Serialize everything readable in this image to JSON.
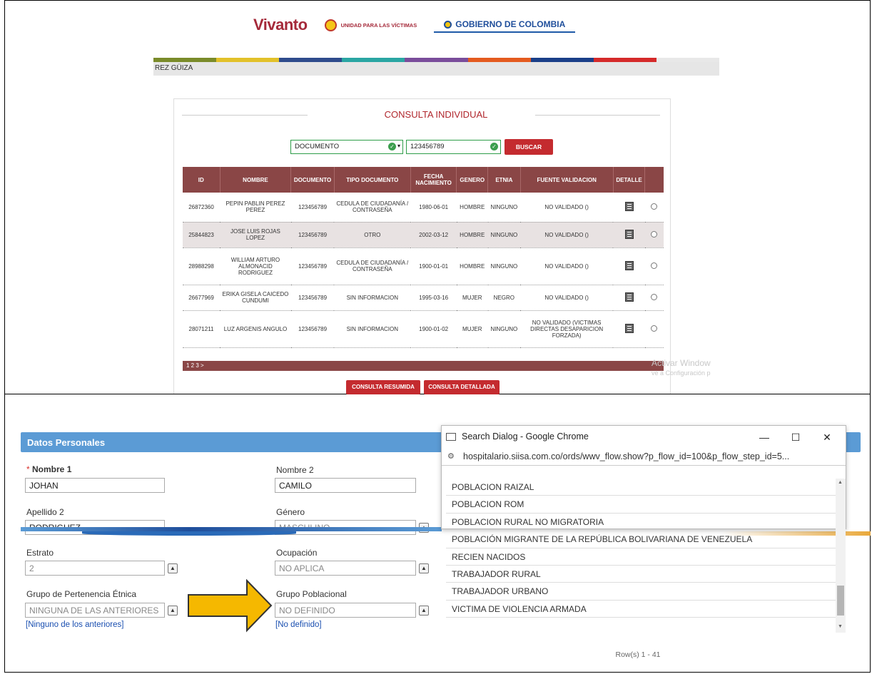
{
  "top": {
    "brand": {
      "vivanto": "Vivanto",
      "unidad": "UNIDAD PARA LAS VÍCTIMAS",
      "gobierno": "GOBIERNO DE COLOMBIA"
    },
    "user_name": "REZ GÜIZA",
    "strip_colors": [
      "#7a8b2a",
      "#e2c12a",
      "#2f4c8c",
      "#2ba6a3",
      "#7a4d9b",
      "#e45b1f",
      "#1a3f88",
      "#d52a2a",
      "#e8e8e8"
    ],
    "title": "CONSULTA INDIVIDUAL",
    "search": {
      "type_value": "DOCUMENTO",
      "doc_value": "123456789",
      "button": "BUSCAR"
    },
    "table": {
      "headers": [
        "ID",
        "NOMBRE",
        "DOCUMENTO",
        "TIPO DOCUMENTO",
        "FECHA NACIMIENTO",
        "GENERO",
        "ETNIA",
        "FUENTE VALIDACION",
        "DETALLE"
      ],
      "rows": [
        {
          "id": "26872360",
          "nombre": "PEPIN PABLIN PEREZ PEREZ",
          "documento": "123456789",
          "tipo": "CEDULA DE CIUDADANÍA / CONTRASEÑA",
          "fecha": "1980-06-01",
          "genero": "HOMBRE",
          "etnia": "NINGUNO",
          "fuente": "NO VALIDADO ()"
        },
        {
          "id": "25844823",
          "nombre": "JOSE LUIS ROJAS LOPEZ",
          "documento": "123456789",
          "tipo": "OTRO",
          "fecha": "2002-03-12",
          "genero": "HOMBRE",
          "etnia": "NINGUNO",
          "fuente": "NO VALIDADO ()"
        },
        {
          "id": "28988298",
          "nombre": "WILLIAM ARTURO ALMONACID RODRIGUEZ",
          "documento": "123456789",
          "tipo": "CEDULA DE CIUDADANÍA / CONTRASEÑA",
          "fecha": "1900-01-01",
          "genero": "HOMBRE",
          "etnia": "NINGUNO",
          "fuente": "NO VALIDADO ()"
        },
        {
          "id": "26677969",
          "nombre": "ERIKA GISELA CAICEDO CUNDUMI",
          "documento": "123456789",
          "tipo": "SIN INFORMACION",
          "fecha": "1995-03-16",
          "genero": "MUJER",
          "etnia": "NEGRO",
          "fuente": "NO VALIDADO ()"
        },
        {
          "id": "28071211",
          "nombre": "LUZ ARGENIS ANGULO",
          "documento": "123456789",
          "tipo": "SIN INFORMACION",
          "fecha": "1900-01-02",
          "genero": "MUJER",
          "etnia": "NINGUNO",
          "fuente": "NO VALIDADO (VICTIMAS DIRECTAS DESAPARICION FORZADA)"
        }
      ],
      "pager": "1 2 3 >"
    },
    "buttons": {
      "resumida": "CONSULTA RESUMIDA",
      "detallada": "CONSULTA DETALLADA"
    },
    "watermark": {
      "line1": "Activar Window",
      "line2": "ve a Configuración p"
    }
  },
  "bottom": {
    "section_title": "Datos Personales",
    "fields": {
      "nombre1": {
        "label": "Nombre 1",
        "value": "JOHAN"
      },
      "nombre2": {
        "label": "Nombre 2",
        "value": "CAMILO"
      },
      "apellido2": {
        "label": "Apellido 2",
        "value": "RODRIGUEZ"
      },
      "genero": {
        "label": "Género",
        "value": "MASCULINO"
      },
      "estrato": {
        "label": "Estrato",
        "value": "2"
      },
      "ocupacion": {
        "label": "Ocupación",
        "value": "NO APLICA"
      },
      "etnica": {
        "label": "Grupo de Pertenencia Étnica",
        "value": "NINGUNA DE LAS ANTERIORES",
        "link": "[Ninguno de los anteriores]"
      },
      "poblacional": {
        "label": "Grupo Poblacional",
        "value": "NO DEFINIDO",
        "link": "[No definido]"
      }
    },
    "dialog": {
      "title": "Search Dialog - Google Chrome",
      "url": "hospitalario.siisa.com.co/ords/wwv_flow.show?p_flow_id=100&p_flow_step_id=5...",
      "items": [
        "POBLACION RAIZAL",
        "POBLACION ROM",
        "POBLACION RURAL NO MIGRATORIA",
        "POBLACIÓN MIGRANTE DE LA REPÚBLICA BOLIVARIANA DE VENEZUELA",
        "RECIEN NACIDOS",
        "TRABAJADOR RURAL",
        "TRABAJADOR URBANO",
        "VICTIMA DE VIOLENCIA ARMADA"
      ],
      "footer": "Row(s) 1 - 41"
    },
    "arrow_color": "#f5b800"
  }
}
